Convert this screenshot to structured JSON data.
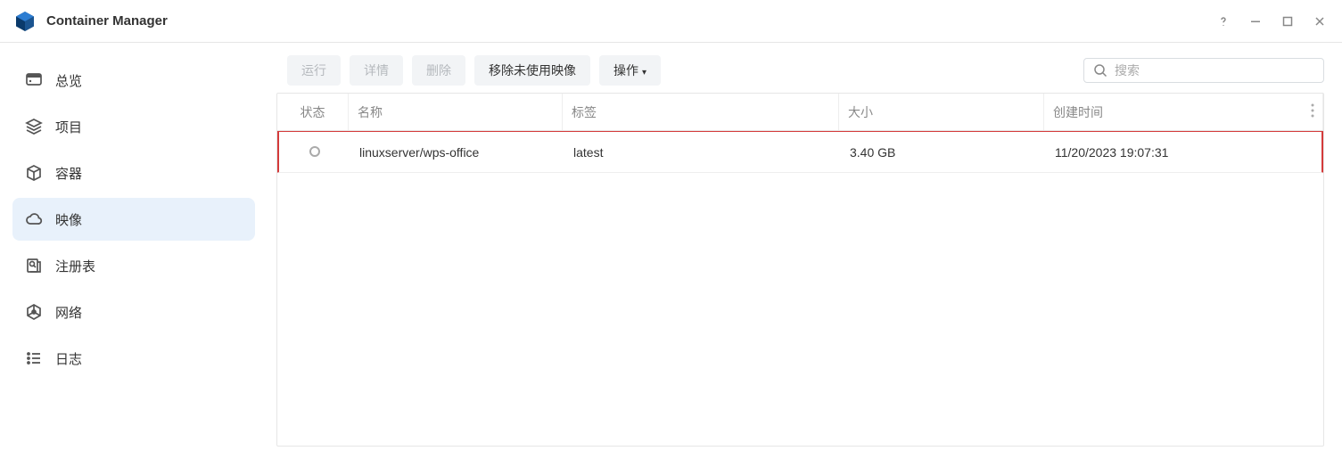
{
  "app": {
    "title": "Container Manager"
  },
  "sidebar": {
    "items": [
      {
        "label": "总览",
        "icon": "dashboard"
      },
      {
        "label": "项目",
        "icon": "layers"
      },
      {
        "label": "容器",
        "icon": "cube"
      },
      {
        "label": "映像",
        "icon": "cloud",
        "active": true
      },
      {
        "label": "注册表",
        "icon": "registry"
      },
      {
        "label": "网络",
        "icon": "network"
      },
      {
        "label": "日志",
        "icon": "list"
      }
    ]
  },
  "toolbar": {
    "run": "运行",
    "detail": "详情",
    "delete": "删除",
    "remove_unused": "移除未使用映像",
    "action": "操作",
    "search_placeholder": "搜索"
  },
  "table": {
    "headers": {
      "status": "状态",
      "name": "名称",
      "tag": "标签",
      "size": "大小",
      "created": "创建时间"
    },
    "rows": [
      {
        "status": "stopped",
        "name": "linuxserver/wps-office",
        "tag": "latest",
        "size": "3.40 GB",
        "created": "11/20/2023 19:07:31"
      }
    ]
  }
}
